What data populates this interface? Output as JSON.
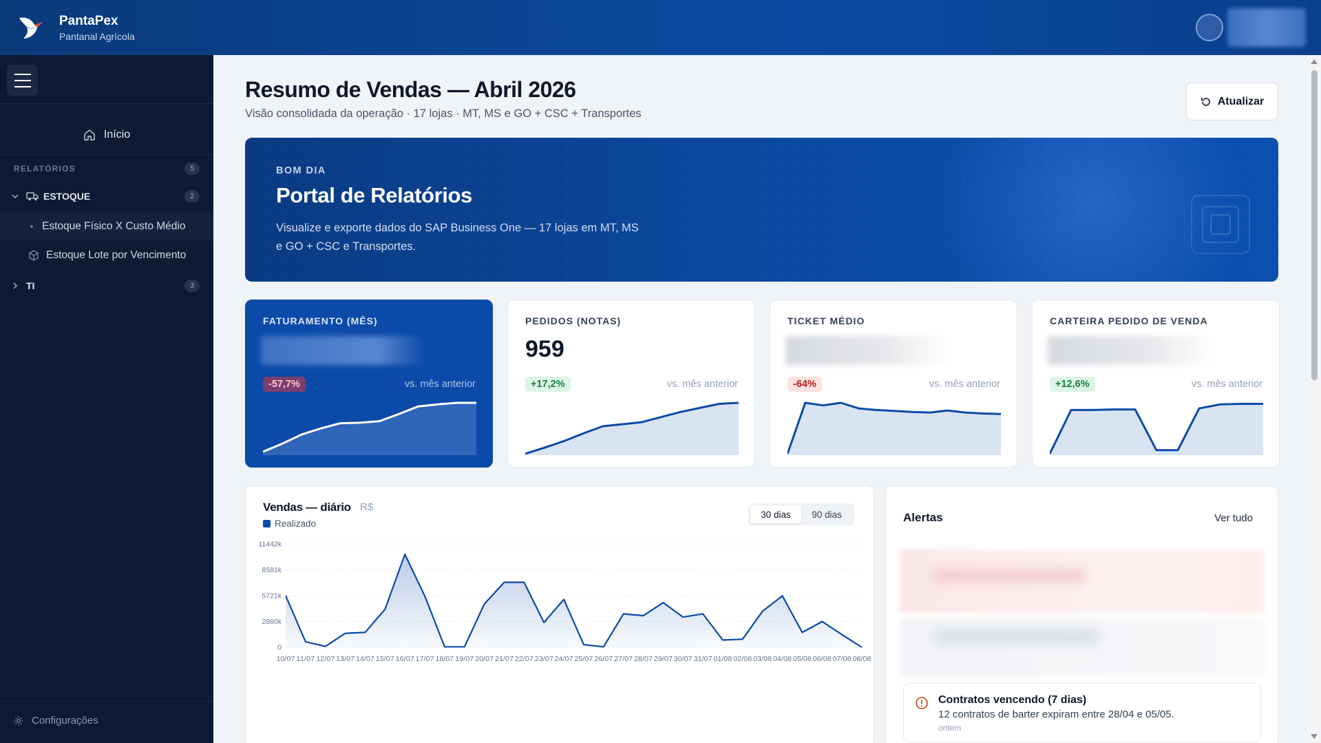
{
  "brand": {
    "name": "PantaPex",
    "subtitle": "Pantanal Agrícola"
  },
  "sidebar": {
    "home_label": "Início",
    "section_label": "RELATÓRIOS",
    "section_count": "5",
    "groups": [
      {
        "label": "ESTOQUE",
        "count": "2",
        "expanded": true,
        "items": [
          {
            "label": "Estoque Físico X Custo Médio"
          },
          {
            "label": "Estoque Lote por Vencimento"
          }
        ]
      },
      {
        "label": "TI",
        "count": "3",
        "expanded": false
      }
    ],
    "settings_label": "Configurações"
  },
  "page": {
    "title": "Resumo de Vendas — Abril 2026",
    "subtitle": "Visão consolidada da operação · 17 lojas · MT, MS e GO + CSC + Transportes",
    "refresh_label": "Atualizar"
  },
  "hero": {
    "eyebrow": "BOM DIA",
    "title": "Portal de Relatórios",
    "description": "Visualize e exporte dados do SAP Business One — 17 lojas em MT, MS e GO + CSC e Transportes."
  },
  "kpis": [
    {
      "label": "FATURAMENTO (MÊS)",
      "value": "",
      "delta": "-57,7%",
      "direction": "down",
      "compare": "vs. mês anterior",
      "trend": [
        0.04,
        0.2,
        0.38,
        0.5,
        0.6,
        0.61,
        0.64,
        0.78,
        0.93,
        0.97,
        1.0,
        1.0
      ]
    },
    {
      "label": "PEDIDOS (NOTAS)",
      "value": "959",
      "delta": "+17,2%",
      "direction": "up",
      "compare": "vs. mês anterior",
      "trend": [
        0.0,
        0.12,
        0.25,
        0.4,
        0.54,
        0.58,
        0.62,
        0.72,
        0.82,
        0.9,
        0.98,
        1.0
      ]
    },
    {
      "label": "TICKET MÉDIO",
      "value": "",
      "delta": "-64%",
      "direction": "down",
      "compare": "vs. mês anterior",
      "trend": [
        0.0,
        1.0,
        0.95,
        1.0,
        0.89,
        0.86,
        0.84,
        0.82,
        0.81,
        0.85,
        0.81,
        0.79,
        0.78
      ]
    },
    {
      "label": "CARTEIRA PEDIDO DE VENDA",
      "value": "",
      "delta": "+12,6%",
      "direction": "up",
      "compare": "vs. mês anterior",
      "trend": [
        0.0,
        0.86,
        0.86,
        0.87,
        0.87,
        0.07,
        0.07,
        0.89,
        0.97,
        0.98,
        0.98
      ]
    }
  ],
  "sales_chart": {
    "title": "Vendas — diário",
    "unit": "R$",
    "legend": "Realizado",
    "ranges": [
      {
        "label": "30 dias",
        "active": true
      },
      {
        "label": "90 dias",
        "active": false
      }
    ]
  },
  "chart_data": {
    "type": "area",
    "title": "Vendas — diário",
    "series": [
      {
        "name": "Realizado",
        "values": [
          5721,
          600,
          100,
          1550,
          1650,
          4200,
          10300,
          5700,
          50,
          50,
          4800,
          7200,
          7200,
          2750,
          5300,
          300,
          50,
          3700,
          3500,
          4950,
          3350,
          3700,
          800,
          900,
          4000,
          5700,
          1650,
          2850,
          1400,
          0
        ]
      }
    ],
    "x": [
      "10/07",
      "11/07",
      "12/07",
      "13/07",
      "14/07",
      "15/07",
      "16/07",
      "17/07",
      "18/07",
      "19/07",
      "20/07",
      "21/07",
      "22/07",
      "23/07",
      "24/07",
      "25/07",
      "26/07",
      "27/07",
      "28/07",
      "29/07",
      "30/07",
      "31/07",
      "01/08",
      "02/08",
      "03/08",
      "04/08",
      "05/08",
      "06/08",
      "07/08",
      "08/08"
    ],
    "y_ticks": [
      "0",
      "2860k",
      "5721k",
      "8581k",
      "11442k"
    ],
    "ylim": [
      0,
      11442
    ],
    "grid": true,
    "legend_position": "top-left"
  },
  "alerts": {
    "title": "Alertas",
    "link_label": "Ver tudo",
    "items": [
      {
        "title": "Contratos vencendo (7 dias)",
        "body": "12 contratos de barter expiram entre 28/04 e 05/05.",
        "time": "ontem"
      }
    ]
  },
  "colors": {
    "brand_blue": "#0b4aa8",
    "sidebar_bg": "#0e1a33",
    "positive": "#15803d",
    "negative": "#b91c1c"
  }
}
